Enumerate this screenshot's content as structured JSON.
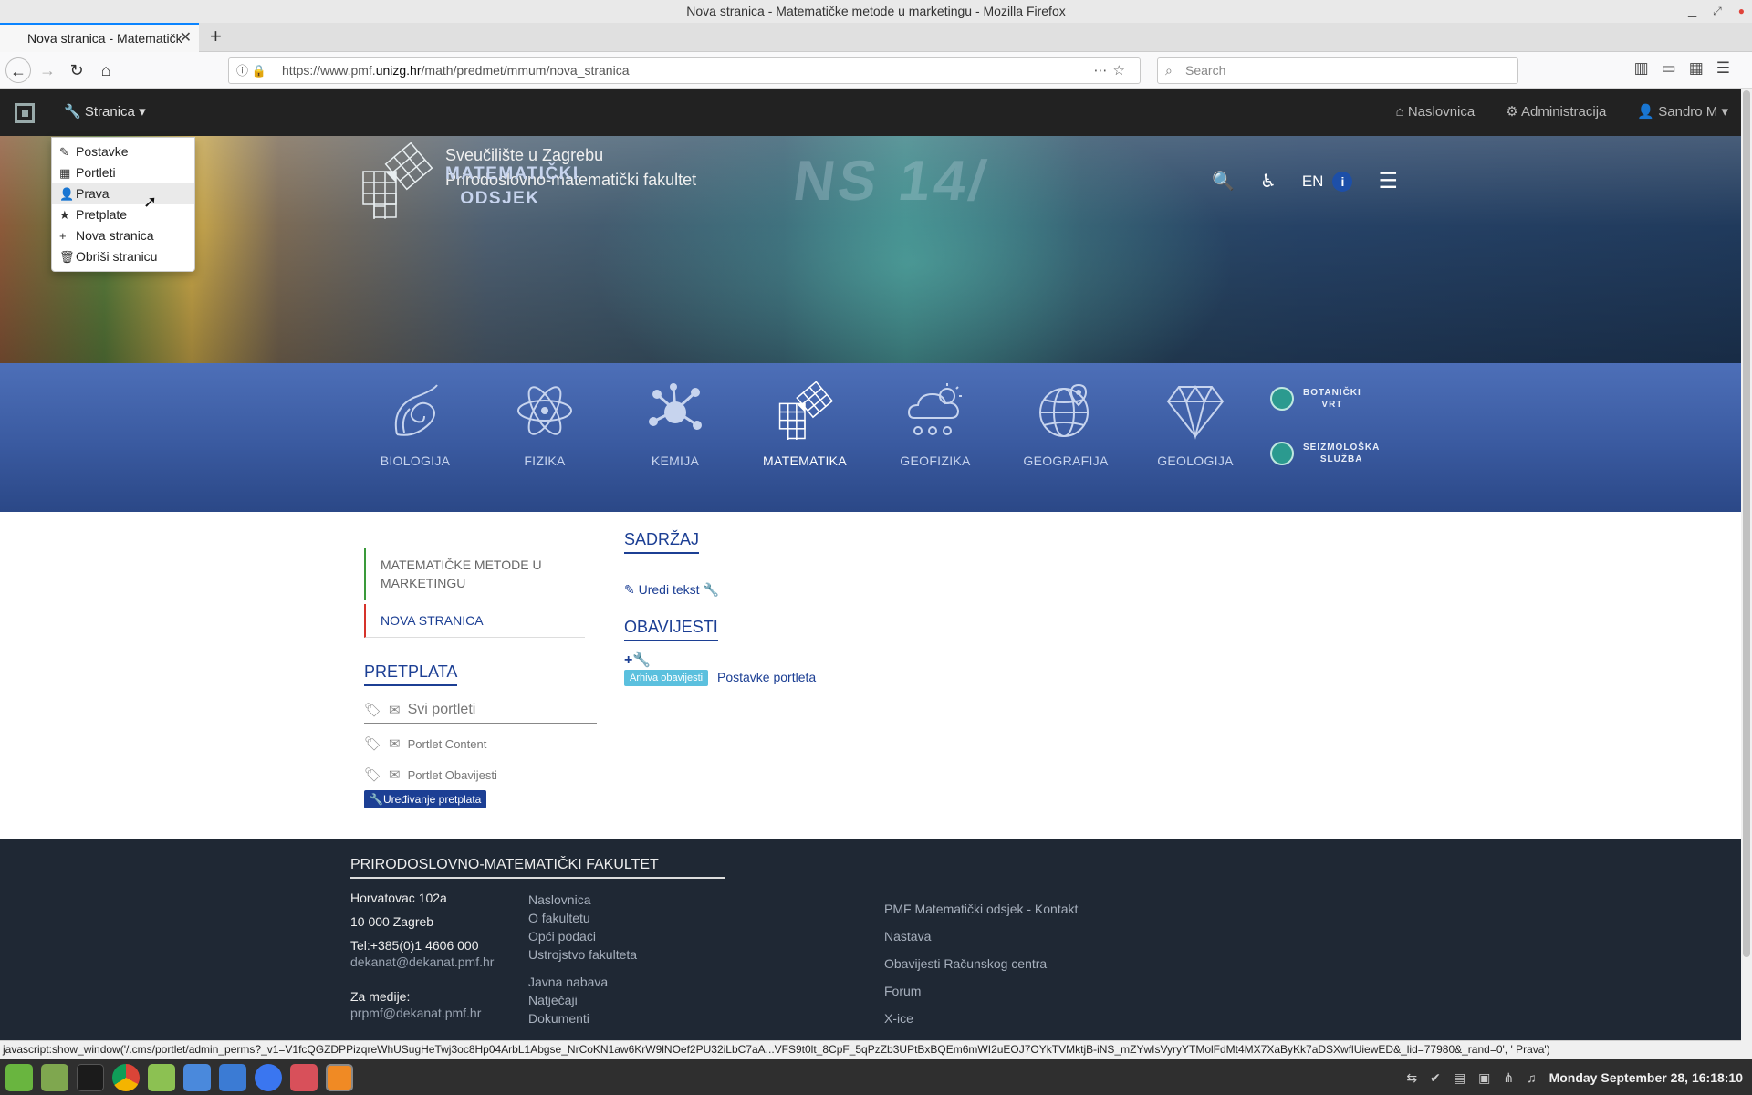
{
  "window": {
    "title": "Nova stranica - Matematičke metode u marketingu - Mozilla Firefox"
  },
  "browser": {
    "tab_title": "Nova stranica - Matematičk",
    "url_prefix": "https://www.pmf.",
    "url_host": "unizg.hr",
    "url_path": "/math/predmet/mmum/nova_stranica",
    "search_placeholder": "Search",
    "status_text": "javascript:show_window('/.cms/portlet/admin_perms?_v1=V1fcQGZDPPizqreWhUSugHeTwj3oc8Hp04ArbL1Abgse_NrCoKN1aw6KrW9lNOef2PU32iLbC7aA...VFS9t0lt_8CpF_5qPzZb3UPtBxBQEm6mWI2uEOJ7OYkTVMktjB-iNS_mZYwIsVyryYTMolFdMt4MX7XaByKk7aDSXwflUiewED&_lid=77980&_rand=0', ' Prava')"
  },
  "adminbar": {
    "stranica_label": "Stranica",
    "naslovnica": "Naslovnica",
    "administracija": "Administracija",
    "user": "Sandro M"
  },
  "dropdown": {
    "items": [
      {
        "label": "Postavke",
        "icon": "edit-icon"
      },
      {
        "label": "Portleti",
        "icon": "grid-icon"
      },
      {
        "label": "Prava",
        "icon": "user-plus-icon"
      },
      {
        "label": "Pretplate",
        "icon": "star-icon"
      },
      {
        "label": "Nova stranica",
        "icon": "plus-icon"
      },
      {
        "label": "Obriši stranicu",
        "icon": "trash-icon"
      }
    ]
  },
  "header": {
    "university": "Sveučilište u Zagrebu",
    "faculty": "Prirodoslovno-matematički fakultet",
    "department": "MATEMATIČKI ODSJEK",
    "lang": "EN"
  },
  "departments": [
    {
      "label": "BIOLOGIJA"
    },
    {
      "label": "FIZIKA"
    },
    {
      "label": "KEMIJA"
    },
    {
      "label": "MATEMATIKA"
    },
    {
      "label": "GEOFIZIKA"
    },
    {
      "label": "GEOGRAFIJA"
    },
    {
      "label": "GEOLOGIJA"
    }
  ],
  "small_departments": {
    "botanicki_1": "BOTANIČKI",
    "botanicki_2": "VRT",
    "seizmo_1": "SEIZMOLOŠKA",
    "seizmo_2": "SLUŽBA"
  },
  "leftnav": {
    "items": [
      "MATEMATIČKE METODE U MARKETINGU",
      "NOVA STRANICA"
    ]
  },
  "pretplata": {
    "title": "PRETPLATA",
    "svi_portleti": "Svi portleti",
    "portlet_content": "Portlet Content",
    "portlet_obavijesti": "Portlet Obavijesti",
    "edit_button": "Uređivanje pretplata"
  },
  "main": {
    "sadrzaj_title": "SADRŽAJ",
    "uredi_tekst": "Uredi tekst",
    "obavijesti_title": "OBAVIJESTI",
    "arhiva_button": "Arhiva obavijesti",
    "postavke_portleta": "Postavke portleta"
  },
  "footer": {
    "title": "PRIRODOSLOVNO-MATEMATIČKI FAKULTET",
    "address1": "Horvatovac 102a",
    "address2": "10 000 Zagreb",
    "tel": "Tel:+385(0)1 4606 000",
    "email1": "dekanat@dekanat.pmf.hr",
    "za_medije": "Za medije:",
    "email2": "prpmf@dekanat.pmf.hr",
    "links1": [
      "Naslovnica",
      "O fakultetu",
      "Opći podaci",
      "Ustrojstvo fakulteta"
    ],
    "links2": [
      "Javna nabava",
      "Natječaji",
      "Dokumenti"
    ],
    "links3": [
      "PMF Matematički odsjek - Kontakt",
      "Nastava",
      "Obavijesti Računskog centra",
      "Forum",
      "X-ice"
    ]
  },
  "taskbar": {
    "clock": "Monday September 28, 16:18:10"
  },
  "colors": {
    "brand_blue": "#1c3f94",
    "accent_cyan": "#5bc0de",
    "adminbar": "#222222",
    "footer": "#1f2834"
  }
}
